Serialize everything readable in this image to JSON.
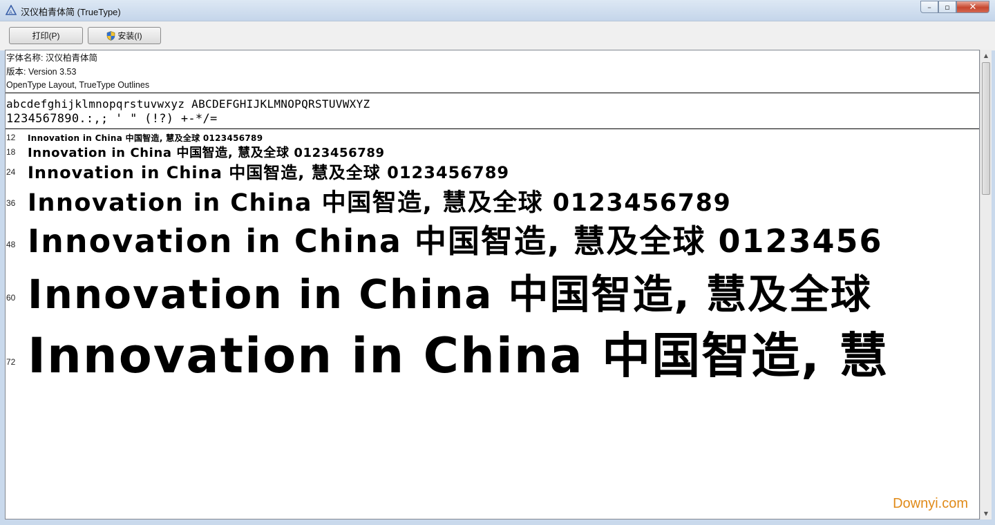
{
  "window": {
    "title": "汉仪柏青体简",
    "title_suffix": "(TrueType)",
    "controls": {
      "minimize": "–",
      "maximize": "▫",
      "close": "✕"
    }
  },
  "toolbar": {
    "print_label": "打印(P)",
    "install_label": "安装(I)"
  },
  "font_info": {
    "name_line": "字体名称: 汉仪柏青体简",
    "version_line": "版本: Version 3.53",
    "outline_line": "OpenType Layout, TrueType Outlines"
  },
  "charset": {
    "line1": "abcdefghijklmnopqrstuvwxyz ABCDEFGHIJKLMNOPQRSTUVWXYZ",
    "line2": "1234567890.:,; ' \" (!?) +-*/="
  },
  "samples": [
    {
      "size": "12",
      "text": "Innovation in China 中国智造, 慧及全球 0123456789",
      "font_px": 12
    },
    {
      "size": "18",
      "text": "Innovation in China 中国智造, 慧及全球 0123456789",
      "font_px": 18
    },
    {
      "size": "24",
      "text": "Innovation in China 中国智造, 慧及全球 0123456789",
      "font_px": 24
    },
    {
      "size": "36",
      "text": "Innovation in China 中国智造, 慧及全球 0123456789",
      "font_px": 35
    },
    {
      "size": "48",
      "text": "Innovation in China 中国智造, 慧及全球 0123456",
      "font_px": 46
    },
    {
      "size": "60",
      "text": "Innovation in China 中国智造, 慧及全球",
      "font_px": 58
    },
    {
      "size": "72",
      "text": "Innovation in China 中国智造, 慧",
      "font_px": 70
    }
  ],
  "watermark": "Downyi.com"
}
